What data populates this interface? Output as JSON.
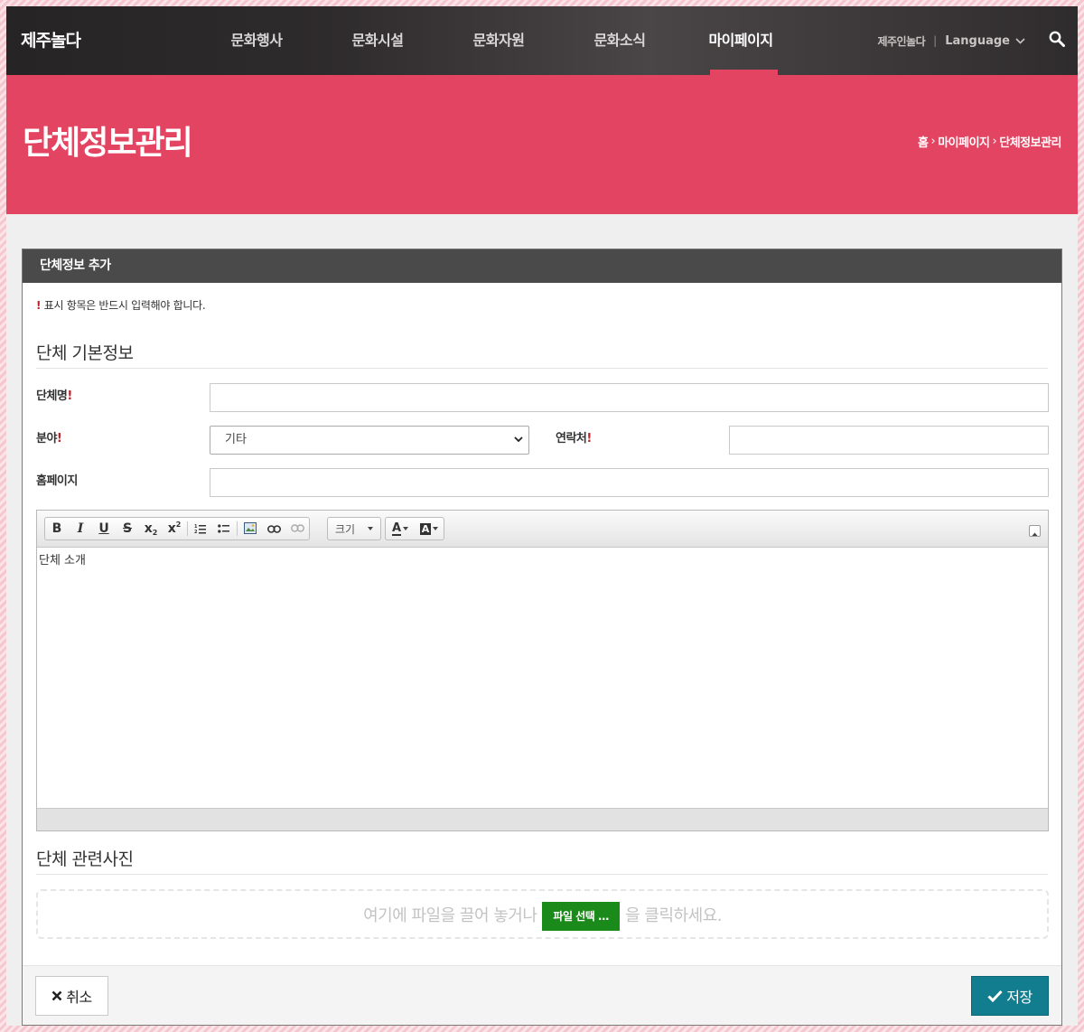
{
  "header": {
    "logo_text": "제주놀다",
    "menu": [
      {
        "label": "문화행사"
      },
      {
        "label": "문화시설"
      },
      {
        "label": "문화자원"
      },
      {
        "label": "문화소식"
      },
      {
        "label": "마이페이지",
        "active": true
      }
    ],
    "util_link": "제주인놀다",
    "language": "Language",
    "accent_color": "#e34461"
  },
  "banner": {
    "title": "단체정보관리",
    "breadcrumb": [
      "홈",
      "마이페이지",
      "단체정보관리"
    ]
  },
  "panel": {
    "header_title": "단체정보 추가",
    "required_note": "표시 항목은 반드시 입력해야 합니다.",
    "required_mark": "!",
    "section_basic": "단체 기본정보",
    "fields": {
      "name_label": "단체명",
      "field_label": "분야",
      "field_value": "기타",
      "contact_label": "연락처",
      "homepage_label": "홈페이지"
    },
    "editor": {
      "toolbar": [
        "bold",
        "italic",
        "underline",
        "strike",
        "subscript",
        "superscript",
        "ordered-list",
        "unordered-list",
        "image",
        "link",
        "unlink",
        "size",
        "text-color",
        "bg-color"
      ],
      "size_label": "크기",
      "content": "단체 소개"
    },
    "section_photo": "단체 관련사진",
    "dropzone": {
      "text_before": "여기에 파일을 끌어 놓거나",
      "button": "파일 선택 ...",
      "text_after": "을 클릭하세요."
    },
    "cancel_label": "취소",
    "save_label": "저장",
    "save_color": "#127d8f"
  }
}
